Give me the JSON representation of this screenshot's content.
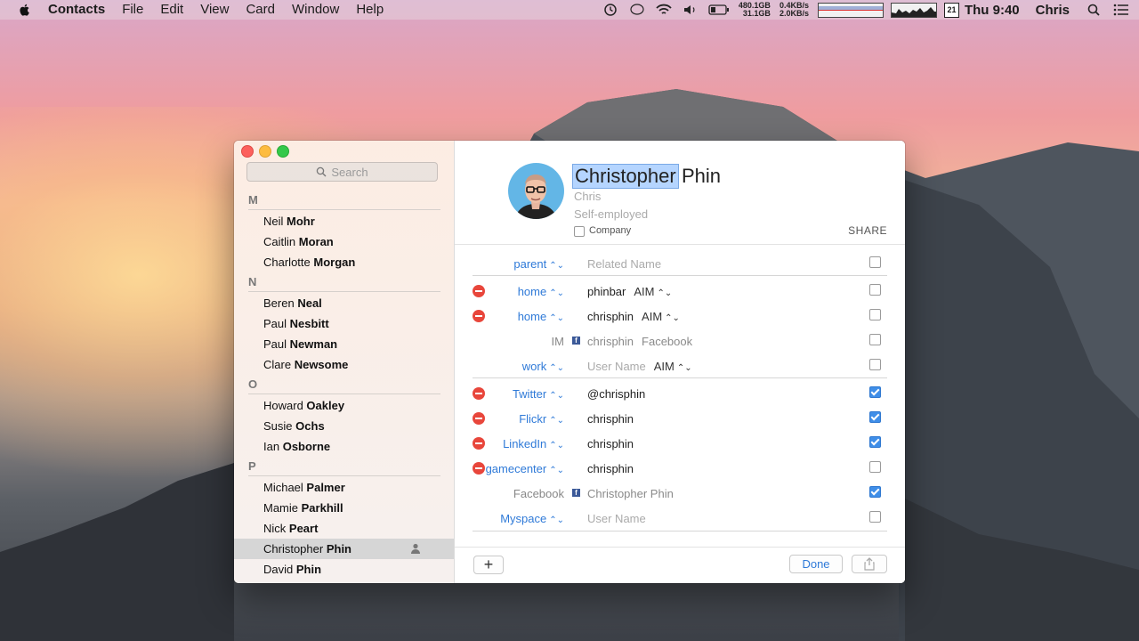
{
  "menubar": {
    "app_name": "Contacts",
    "menus": [
      "File",
      "Edit",
      "View",
      "Card",
      "Window",
      "Help"
    ],
    "disk_stats": [
      "480.1GB",
      "31.1GB"
    ],
    "net_stats": [
      "0.4KB/s",
      "2.0KB/s"
    ],
    "calendar_day": "21",
    "clock": "Thu 9:40",
    "user": "Chris"
  },
  "sidebar": {
    "search_placeholder": "Search",
    "sections": [
      {
        "letter": "M",
        "contacts": [
          {
            "first": "Neil",
            "last": "Mohr"
          },
          {
            "first": "Caitlin",
            "last": "Moran"
          },
          {
            "first": "Charlotte",
            "last": "Morgan"
          }
        ]
      },
      {
        "letter": "N",
        "contacts": [
          {
            "first": "Beren",
            "last": "Neal"
          },
          {
            "first": "Paul",
            "last": "Nesbitt"
          },
          {
            "first": "Paul",
            "last": "Newman"
          },
          {
            "first": "Clare",
            "last": "Newsome"
          }
        ]
      },
      {
        "letter": "O",
        "contacts": [
          {
            "first": "Howard",
            "last": "Oakley"
          },
          {
            "first": "Susie",
            "last": "Ochs"
          },
          {
            "first": "Ian",
            "last": "Osborne"
          }
        ]
      },
      {
        "letter": "P",
        "contacts": [
          {
            "first": "Michael",
            "last": "Palmer"
          },
          {
            "first": "Mamie",
            "last": "Parkhill"
          },
          {
            "first": "Nick",
            "last": "Peart"
          },
          {
            "first": "Christopher",
            "last": "Phin",
            "selected": true
          },
          {
            "first": "David",
            "last": "Phin"
          }
        ]
      }
    ]
  },
  "card": {
    "first_name": "Christopher",
    "last_name": "Phin",
    "nickname": "Chris",
    "company": "Self-employed",
    "company_checkbox_label": "Company",
    "share_header": "SHARE",
    "fields": [
      {
        "label": "parent",
        "label_style": "blue",
        "value": "Related Name",
        "placeholder": true,
        "shared": false
      },
      {
        "label": "home",
        "label_style": "blue",
        "removable": true,
        "value": "phinbar",
        "service": "AIM",
        "shared": false
      },
      {
        "label": "home",
        "label_style": "blue",
        "removable": true,
        "value": "chrisphin",
        "service": "AIM",
        "shared": false
      },
      {
        "label": "IM",
        "label_style": "gray",
        "facebook": true,
        "value": "chrisphin",
        "service": "Facebook",
        "dim": true,
        "shared": false
      },
      {
        "label": "work",
        "label_style": "blue",
        "value": "User Name",
        "placeholder": true,
        "service": "AIM",
        "shared": false
      },
      {
        "label": "Twitter",
        "label_style": "blue",
        "removable": true,
        "value": "@chrisphin",
        "shared": true
      },
      {
        "label": "Flickr",
        "label_style": "blue",
        "removable": true,
        "value": "chrisphin",
        "shared": true
      },
      {
        "label": "LinkedIn",
        "label_style": "blue",
        "removable": true,
        "value": "chrisphin",
        "shared": true
      },
      {
        "label": "gamecenter",
        "label_style": "blue",
        "removable": true,
        "value": "chrisphin",
        "shared": false
      },
      {
        "label": "Facebook",
        "label_style": "gray",
        "facebook": true,
        "value": "Christopher Phin",
        "dim": true,
        "shared": true
      },
      {
        "label": "Myspace",
        "label_style": "blue",
        "value": "User Name",
        "placeholder": true,
        "shared": false
      }
    ],
    "buttons": {
      "add": "+",
      "done": "Done"
    }
  }
}
